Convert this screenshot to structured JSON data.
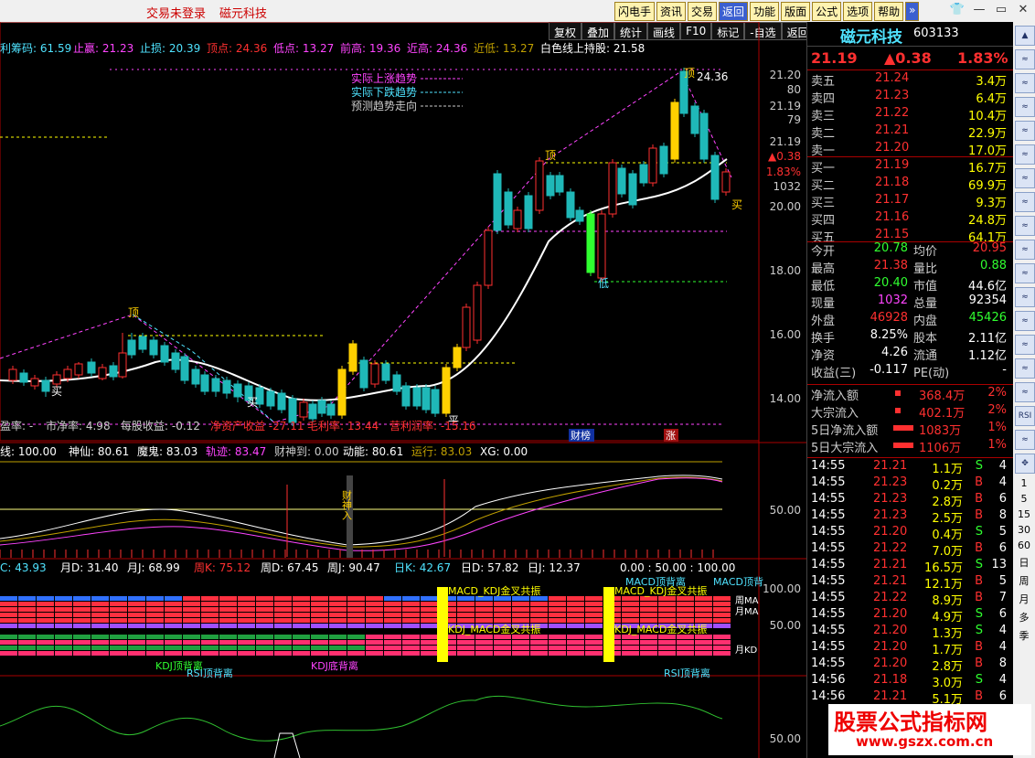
{
  "titlebar": {
    "status": "交易未登录",
    "stock": "磁元科技"
  },
  "menu": [
    "闪电手",
    "资讯",
    "交易",
    "返回",
    "功能",
    "版面",
    "公式",
    "选项",
    "帮助",
    "»"
  ],
  "toolbar": [
    "复权",
    "叠加",
    "统计",
    "画线",
    "F10",
    "标记",
    "-自选",
    "返回"
  ],
  "chart": {
    "top_info": [
      {
        "text": "利筹码: 61.59",
        "color": "#4fe3ff"
      },
      {
        "text": "止赢: 21.23",
        "color": "#ff44ff"
      },
      {
        "text": "止损: 20.39",
        "color": "#4fe3ff"
      },
      {
        "text": "顶点: 24.36",
        "color": "#ff3030"
      },
      {
        "text": "低点: 13.27",
        "color": "#ff44ff"
      },
      {
        "text": "前高: 19.36",
        "color": "#ff44ff"
      },
      {
        "text": "近高: 24.36",
        "color": "#ff44ff"
      },
      {
        "text": "近低: 13.27",
        "color": "#c0a000"
      },
      {
        "text": "白色线上持股: 21.58",
        "color": "#fff"
      }
    ],
    "legend": [
      {
        "text": "实际上涨趋势",
        "color": "#ff44ff"
      },
      {
        "text": "实际下跌趋势",
        "color": "#4fe3ff"
      },
      {
        "text": "预测趋势走向",
        "color": "#ccc"
      }
    ],
    "price_axis": [
      "21.20",
      "80",
      "21.19",
      "79",
      "21.19",
      "▲0.38",
      "1.83%",
      "1032",
      "20.00",
      "18.00",
      "16.00",
      "14.00"
    ],
    "candle_labels": {
      "peak": "24.36",
      "top1": "顶",
      "top2": "顶",
      "top3": "顶",
      "buy": "买",
      "buy2": "买",
      "buy3": "买",
      "low": "低",
      "cai_bang": "财榜",
      "zhang": "涨",
      "ping": "平"
    },
    "bottom_info": [
      {
        "text": "盈率: -",
        "color": "#ccc"
      },
      {
        "text": "市净率: 4.98",
        "color": "#ccc"
      },
      {
        "text": "每股收益: -0.12",
        "color": "#ccc"
      },
      {
        "text": "净资产收益 -27.11",
        "color": "#ff3030"
      },
      {
        "text": "毛利率: 13.44",
        "color": "#ff3030"
      },
      {
        "text": "营利润率: -15.16",
        "color": "#ff3030"
      }
    ],
    "ind1_header": [
      {
        "text": "线: 100.00",
        "color": "#fff"
      },
      {
        "text": "神仙: 80.61",
        "color": "#fff"
      },
      {
        "text": "魔鬼: 83.03",
        "color": "#fff"
      },
      {
        "text": "轨迹: 83.47",
        "color": "#ff44ff"
      },
      {
        "text": "财神到: 0.00",
        "color": "#ccc"
      },
      {
        "text": "动能: 80.61",
        "color": "#fff"
      },
      {
        "text": "运行: 83.03",
        "color": "#c0a000"
      },
      {
        "text": "XG: 0.00",
        "color": "#fff"
      }
    ],
    "ind1_axis": "50.00",
    "ind1_marker": "财神入",
    "ind2_header": [
      {
        "text": "C: 43.93",
        "color": "#4fe3ff"
      },
      {
        "text": "月D: 31.40",
        "color": "#fff"
      },
      {
        "text": "月J: 68.99",
        "color": "#fff"
      },
      {
        "text": "周K: 75.12",
        "color": "#ff3030"
      },
      {
        "text": "周D: 67.45",
        "color": "#fff"
      },
      {
        "text": "周J: 90.47",
        "color": "#fff"
      },
      {
        "text": "日K: 42.67",
        "color": "#4fe3ff"
      },
      {
        "text": "日D: 57.82",
        "color": "#fff"
      },
      {
        "text": "日J: 12.37",
        "color": "#fff"
      },
      {
        "text": "0.00 : 50.00 : 100.00",
        "color": "#fff"
      }
    ],
    "ind2_axis": [
      "100.00",
      "50.00"
    ],
    "ind2_labels": {
      "macd_top1": "MACD顶背离",
      "macd_top2": "MACD顶背",
      "macd_kdj1": "MACD_KDJ金叉共振",
      "macd_kdj2": "MACD_KDJ金叉共振",
      "kdj_macd1": "KDJ_MACD金叉共振",
      "kdj_macd2": "KDJ_MACD金叉共振",
      "kdj_top": "KDJ顶背离",
      "rsi_top1": "RSI顶背离",
      "kdj_bottom": "KDJ底背离",
      "rsi_top2": "RSI顶背离",
      "zhou": "周MA",
      "yue": "月MA",
      "yuekd": "月KD"
    },
    "ind3_axis": "50.00"
  },
  "quote": {
    "name": "磁元科技",
    "code": "603133",
    "price": "21.19",
    "change": "▲0.38",
    "pct": "1.83%",
    "sell": [
      {
        "label": "卖五",
        "price": "21.24",
        "vol": "3.4万"
      },
      {
        "label": "卖四",
        "price": "21.23",
        "vol": "6.4万"
      },
      {
        "label": "卖三",
        "price": "21.22",
        "vol": "10.4万"
      },
      {
        "label": "卖二",
        "price": "21.21",
        "vol": "22.9万"
      },
      {
        "label": "卖一",
        "price": "21.20",
        "vol": "17.0万"
      }
    ],
    "buy": [
      {
        "label": "买一",
        "price": "21.19",
        "vol": "16.7万"
      },
      {
        "label": "买二",
        "price": "21.18",
        "vol": "69.9万"
      },
      {
        "label": "买三",
        "price": "21.17",
        "vol": "9.3万"
      },
      {
        "label": "买四",
        "price": "21.16",
        "vol": "24.8万"
      },
      {
        "label": "买五",
        "price": "21.15",
        "vol": "64.1万"
      }
    ],
    "stats": [
      {
        "l1": "今开",
        "v1": "20.78",
        "c1": "#30ff30",
        "l2": "均价",
        "v2": "20.95",
        "c2": "#ff3030"
      },
      {
        "l1": "最高",
        "v1": "21.38",
        "c1": "#ff3030",
        "l2": "量比",
        "v2": "0.88",
        "c2": "#30ff30"
      },
      {
        "l1": "最低",
        "v1": "20.40",
        "c1": "#30ff30",
        "l2": "市值",
        "v2": "44.6亿",
        "c2": "#fff"
      },
      {
        "l1": "现量",
        "v1": "1032",
        "c1": "#ff44ff",
        "l2": "总量",
        "v2": "92354",
        "c2": "#fff"
      },
      {
        "l1": "外盘",
        "v1": "46928",
        "c1": "#ff3030",
        "l2": "内盘",
        "v2": "45426",
        "c2": "#30ff30"
      },
      {
        "l1": "换手",
        "v1": "8.25%",
        "c1": "#fff",
        "l2": "股本",
        "v2": "2.11亿",
        "c2": "#fff"
      },
      {
        "l1": "净资",
        "v1": "4.26",
        "c1": "#fff",
        "l2": "流通",
        "v2": "1.12亿",
        "c2": "#fff"
      },
      {
        "l1": "收益(三)",
        "v1": "-0.117",
        "c1": "#fff",
        "l2": "PE(动)",
        "v2": "-",
        "c2": "#fff"
      }
    ],
    "flows": [
      {
        "label": "净流入额",
        "value": "368.4万",
        "pct": "2%"
      },
      {
        "label": "大宗流入",
        "value": "402.1万",
        "pct": "2%"
      },
      {
        "label": "5日净流入额",
        "value": "1083万",
        "pct": "1%"
      },
      {
        "label": "5日大宗流入",
        "value": "1106万",
        "pct": "1%"
      }
    ],
    "ticks": [
      {
        "t": "14:55",
        "p": "21.21",
        "v": "1.1万",
        "d": "S",
        "n": "4"
      },
      {
        "t": "14:55",
        "p": "21.23",
        "v": "0.2万",
        "d": "B",
        "n": "4"
      },
      {
        "t": "14:55",
        "p": "21.23",
        "v": "2.8万",
        "d": "B",
        "n": "6"
      },
      {
        "t": "14:55",
        "p": "21.23",
        "v": "2.5万",
        "d": "B",
        "n": "8"
      },
      {
        "t": "14:55",
        "p": "21.20",
        "v": "0.4万",
        "d": "S",
        "n": "5"
      },
      {
        "t": "14:55",
        "p": "21.22",
        "v": "7.0万",
        "d": "B",
        "n": "6"
      },
      {
        "t": "14:55",
        "p": "21.21",
        "v": "16.5万",
        "d": "S",
        "n": "13"
      },
      {
        "t": "14:55",
        "p": "21.21",
        "v": "12.1万",
        "d": "B",
        "n": "5"
      },
      {
        "t": "14:55",
        "p": "21.22",
        "v": "8.9万",
        "d": "B",
        "n": "7"
      },
      {
        "t": "14:55",
        "p": "21.20",
        "v": "4.9万",
        "d": "S",
        "n": "6"
      },
      {
        "t": "14:55",
        "p": "21.20",
        "v": "1.3万",
        "d": "S",
        "n": "4"
      },
      {
        "t": "14:55",
        "p": "21.20",
        "v": "1.7万",
        "d": "B",
        "n": "4"
      },
      {
        "t": "14:55",
        "p": "21.20",
        "v": "2.8万",
        "d": "B",
        "n": "8"
      },
      {
        "t": "14:56",
        "p": "21.18",
        "v": "3.0万",
        "d": "S",
        "n": "4"
      },
      {
        "t": "14:56",
        "p": "21.21",
        "v": "5.1万",
        "d": "B",
        "n": "6"
      }
    ]
  },
  "sidebar": {
    "icons": [
      "up-icon",
      "expand-icon",
      "list-icon",
      "grid-icon",
      "chart-icon",
      "chart-icon2",
      "chart-icon3",
      "chart-icon4",
      "chart-icon5",
      "chart-icon6",
      "chart-icon7",
      "chart-icon8",
      "chart-icon9",
      "chart-icon10",
      "chart-icon11",
      "chart-icon12",
      "rsi-icon",
      "layers-icon",
      "move-icon"
    ],
    "rsi_label": "RSI",
    "periods": [
      "1",
      "5",
      "15",
      "30",
      "60",
      "日",
      "周",
      "月",
      "多",
      "季"
    ]
  },
  "watermark": {
    "cn": "股票公式指标网",
    "url": "www.gszx.com.cn"
  },
  "colors": {
    "up": "#ff3030",
    "down": "#30ff30",
    "accent": "#4fe3ff",
    "magenta": "#ff44ff",
    "yellow": "#ffff00"
  }
}
